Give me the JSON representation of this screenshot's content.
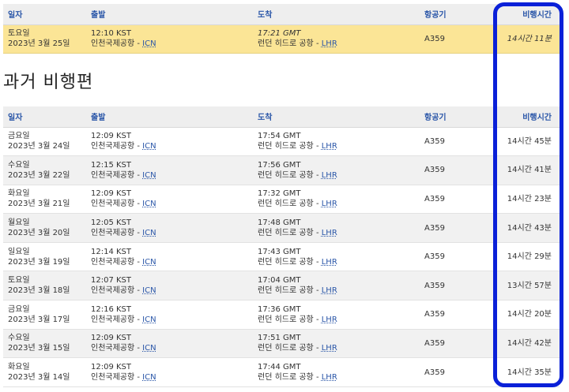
{
  "columns": {
    "date": "일자",
    "departure": "출발",
    "arrival": "도착",
    "aircraft": "항공기",
    "duration": "비행시간"
  },
  "upcoming": {
    "day": "토요일",
    "date": "2023년 3월 25일",
    "dep_time": "12:10 KST",
    "dep_airport": "인천국제공항",
    "dep_code": "ICN",
    "arr_time": "17:21 GMT",
    "arr_airport": "런던 히드로 공항",
    "arr_code": "LHR",
    "aircraft": "A359",
    "duration": "14시간 11분"
  },
  "past_title": "과거 비행편",
  "past": [
    {
      "day": "금요일",
      "date": "2023년 3월 24일",
      "dep_time": "12:09 KST",
      "dep_airport": "인천국제공항",
      "dep_code": "ICN",
      "arr_time": "17:54 GMT",
      "arr_airport": "런던 히드로 공항",
      "arr_code": "LHR",
      "aircraft": "A359",
      "duration": "14시간 45분"
    },
    {
      "day": "수요일",
      "date": "2023년 3월 22일",
      "dep_time": "12:15 KST",
      "dep_airport": "인천국제공항",
      "dep_code": "ICN",
      "arr_time": "17:56 GMT",
      "arr_airport": "런던 히드로 공항",
      "arr_code": "LHR",
      "aircraft": "A359",
      "duration": "14시간 41분"
    },
    {
      "day": "화요일",
      "date": "2023년 3월 21일",
      "dep_time": "12:09 KST",
      "dep_airport": "인천국제공항",
      "dep_code": "ICN",
      "arr_time": "17:32 GMT",
      "arr_airport": "런던 히드로 공항",
      "arr_code": "LHR",
      "aircraft": "A359",
      "duration": "14시간 23분"
    },
    {
      "day": "월요일",
      "date": "2023년 3월 20일",
      "dep_time": "12:05 KST",
      "dep_airport": "인천국제공항",
      "dep_code": "ICN",
      "arr_time": "17:48 GMT",
      "arr_airport": "런던 히드로 공항",
      "arr_code": "LHR",
      "aircraft": "A359",
      "duration": "14시간 43분"
    },
    {
      "day": "일요일",
      "date": "2023년 3월 19일",
      "dep_time": "12:14 KST",
      "dep_airport": "인천국제공항",
      "dep_code": "ICN",
      "arr_time": "17:43 GMT",
      "arr_airport": "런던 히드로 공항",
      "arr_code": "LHR",
      "aircraft": "A359",
      "duration": "14시간 29분"
    },
    {
      "day": "토요일",
      "date": "2023년 3월 18일",
      "dep_time": "12:07 KST",
      "dep_airport": "인천국제공항",
      "dep_code": "ICN",
      "arr_time": "17:04 GMT",
      "arr_airport": "런던 히드로 공항",
      "arr_code": "LHR",
      "aircraft": "A359",
      "duration": "13시간 57분"
    },
    {
      "day": "금요일",
      "date": "2023년 3월 17일",
      "dep_time": "12:16 KST",
      "dep_airport": "인천국제공항",
      "dep_code": "ICN",
      "arr_time": "17:36 GMT",
      "arr_airport": "런던 히드로 공항",
      "arr_code": "LHR",
      "aircraft": "A359",
      "duration": "14시간 20분"
    },
    {
      "day": "수요일",
      "date": "2023년 3월 15일",
      "dep_time": "12:09 KST",
      "dep_airport": "인천국제공항",
      "dep_code": "ICN",
      "arr_time": "17:51 GMT",
      "arr_airport": "런던 히드로 공항",
      "arr_code": "LHR",
      "aircraft": "A359",
      "duration": "14시간 42분"
    },
    {
      "day": "화요일",
      "date": "2023년 3월 14일",
      "dep_time": "12:09 KST",
      "dep_airport": "인천국제공항",
      "dep_code": "ICN",
      "arr_time": "17:44 GMT",
      "arr_airport": "런던 히드로 공항",
      "arr_code": "LHR",
      "aircraft": "A359",
      "duration": "14시간 35분"
    }
  ],
  "colors": {
    "header_text": "#2a56a8",
    "upcoming_row": "#fbe596",
    "highlight_box": "#0a20d8"
  }
}
